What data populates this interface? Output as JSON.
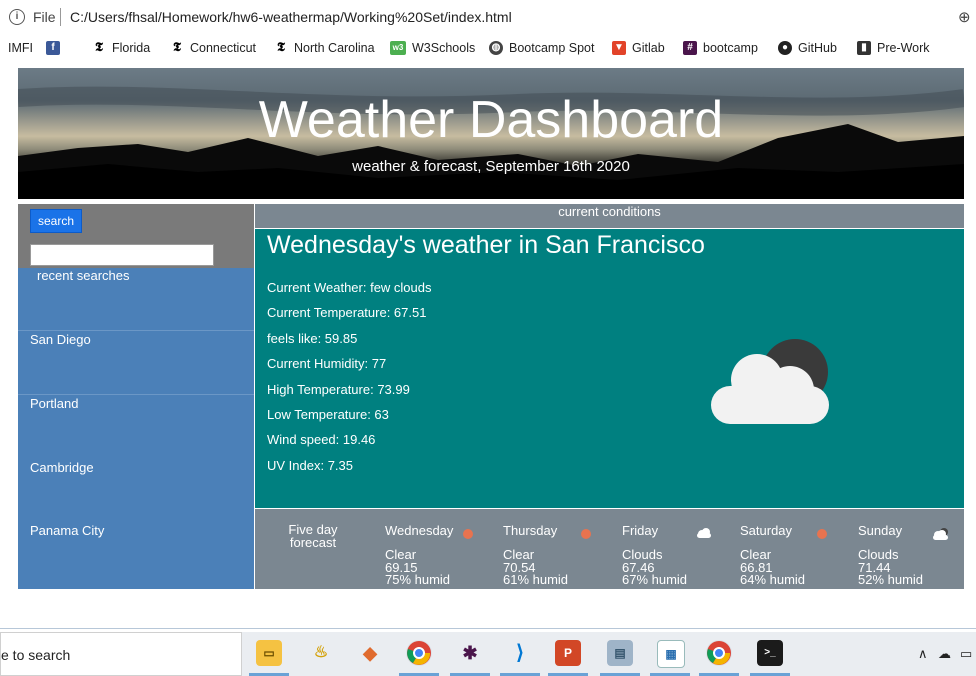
{
  "browser": {
    "file_label": "File",
    "url": "C:/Users/fhsal/Homework/hw6-weathermap/Working%20Set/index.html",
    "bookmarks": [
      {
        "label": "IMFI",
        "icon": "imfi-text"
      },
      {
        "label": "",
        "icon": "facebook-icon"
      },
      {
        "label": "Florida",
        "icon": "nytimes-icon"
      },
      {
        "label": "Connecticut",
        "icon": "nytimes-icon"
      },
      {
        "label": "North Carolina",
        "icon": "nytimes-icon"
      },
      {
        "label": "W3Schools",
        "icon": "w3schools-icon"
      },
      {
        "label": "Bootcamp Spot",
        "icon": "globe-icon"
      },
      {
        "label": "Gitlab",
        "icon": "gitlab-icon"
      },
      {
        "label": "bootcamp",
        "icon": "slack-icon"
      },
      {
        "label": "GitHub",
        "icon": "github-icon"
      },
      {
        "label": "Pre-Work",
        "icon": "book-icon"
      }
    ]
  },
  "header": {
    "title": "Weather Dashboard",
    "subtitle": "weather & forecast, September 16th 2020"
  },
  "sidebar": {
    "search_button": "search",
    "search_value": "",
    "recent_label": "recent searches",
    "recent": [
      "San Diego",
      "Portland",
      "Cambridge",
      "Panama City"
    ]
  },
  "current": {
    "section_label": "current conditions",
    "heading": "Wednesday's weather in San Francisco",
    "rows": [
      "Current Weather: few clouds",
      "Current Temperature: 67.51",
      "feels like: 59.85",
      "Current Humidity: 77",
      "High Temperature: 73.99",
      "Low Temperature: 63",
      "Wind speed: 19.46",
      "UV Index: 7.35"
    ],
    "icon": "cloud-moon-icon"
  },
  "forecast": {
    "label_line1": "Five day",
    "label_line2": "forecast",
    "days": [
      {
        "name": "Wednesday",
        "cond": "Clear",
        "temp": "69.15",
        "humid": "75% humid",
        "icon": "sun-icon"
      },
      {
        "name": "Thursday",
        "cond": "Clear",
        "temp": "70.54",
        "humid": "61% humid",
        "icon": "sun-icon"
      },
      {
        "name": "Friday",
        "cond": "Clouds",
        "temp": "67.46",
        "humid": "67% humid",
        "icon": "cloud-icon"
      },
      {
        "name": "Saturday",
        "cond": "Clear",
        "temp": "66.81",
        "humid": "64% humid",
        "icon": "sun-icon"
      },
      {
        "name": "Sunday",
        "cond": "Clouds",
        "temp": "71.44",
        "humid": "52% humid",
        "icon": "cloud-icon"
      }
    ]
  },
  "taskbar": {
    "search_text": "e to search",
    "apps": [
      "file-explorer-icon",
      "genie-icon",
      "git-icon",
      "chrome-icon",
      "slack-icon",
      "vscode-icon",
      "powerpoint-icon",
      "notepad-icon",
      "browser-window-icon",
      "chrome-icon",
      "terminal-icon"
    ]
  },
  "colors": {
    "sidebar": "#4b80b8",
    "main": "#008080",
    "forecast": "#7b8791",
    "search_button": "#1a73e8",
    "sun": "#e8734f"
  }
}
